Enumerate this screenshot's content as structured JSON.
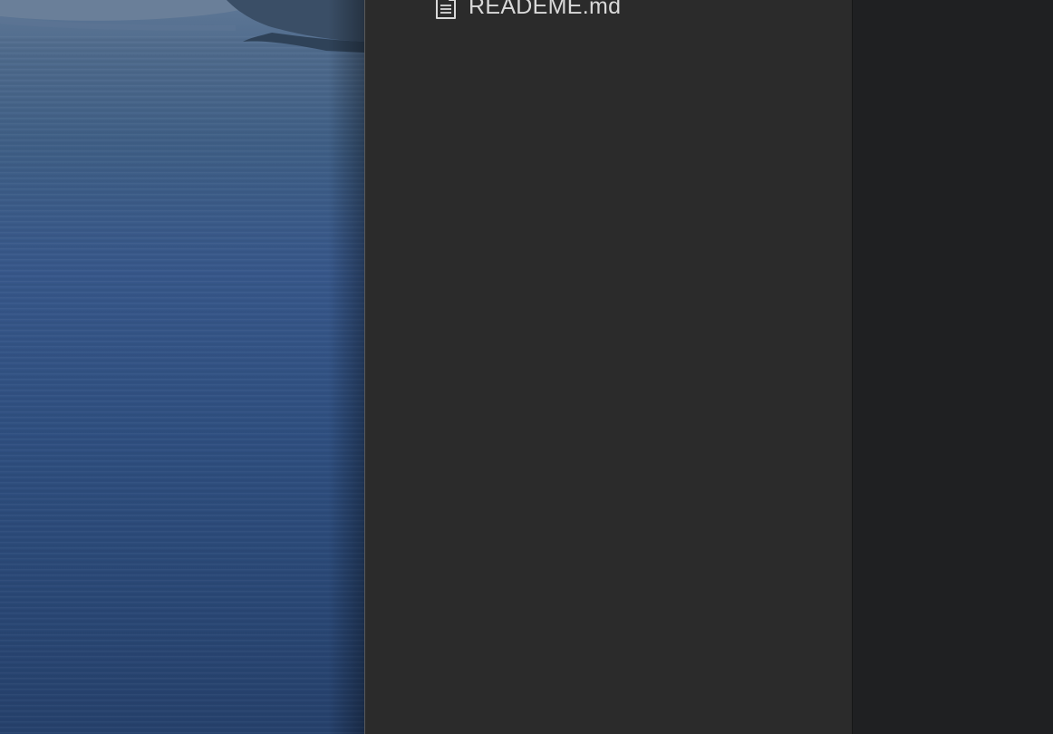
{
  "desktop": {
    "wallpaper": "sea-cliffs-wallpaper"
  },
  "file_list": {
    "items": [
      {
        "label": "READEME.md",
        "icon": "document-icon"
      }
    ]
  },
  "colors": {
    "file_pane_bg": "#2b2b2b",
    "right_pane_bg": "#1f2022",
    "text": "#d9d9d9"
  }
}
